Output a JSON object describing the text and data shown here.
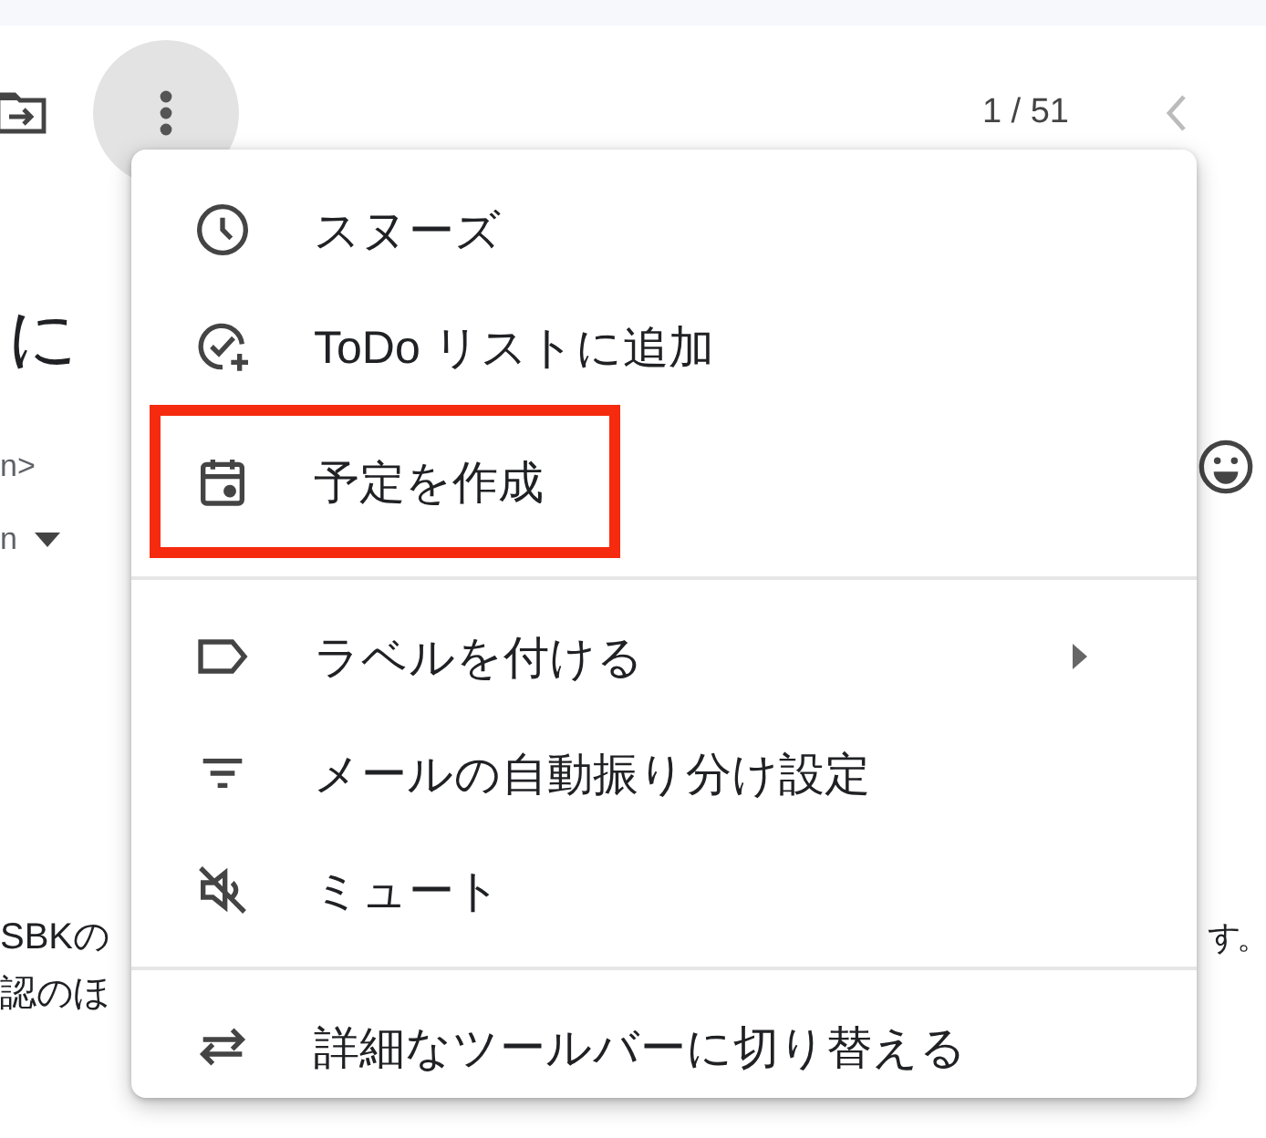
{
  "toolbar": {
    "more_button": {
      "active": true
    },
    "counter": "1 / 51"
  },
  "message": {
    "subject": "に",
    "sender_fragment": "n>",
    "recipient_fragment": "n",
    "body_lines": [
      {
        "start": "SBKの",
        "end": "す。"
      },
      {
        "start": "認のほ"
      }
    ]
  },
  "menu": {
    "sections": [
      {
        "items": [
          {
            "label": "スヌーズ",
            "highlighted": false,
            "submenu": false
          },
          {
            "label": "ToDo リストに追加",
            "highlighted": false,
            "submenu": false
          },
          {
            "label": "予定を作成",
            "highlighted": true,
            "submenu": false
          }
        ]
      },
      {
        "items": [
          {
            "label": "ラベルを付ける",
            "highlighted": false,
            "submenu": true
          },
          {
            "label": "メールの自動振り分け設定",
            "highlighted": false,
            "submenu": false
          },
          {
            "label": "ミュート",
            "highlighted": false,
            "submenu": false
          }
        ]
      },
      {
        "items": [
          {
            "label": "詳細なツールバーに切り替える",
            "highlighted": false,
            "submenu": false
          }
        ]
      }
    ]
  }
}
